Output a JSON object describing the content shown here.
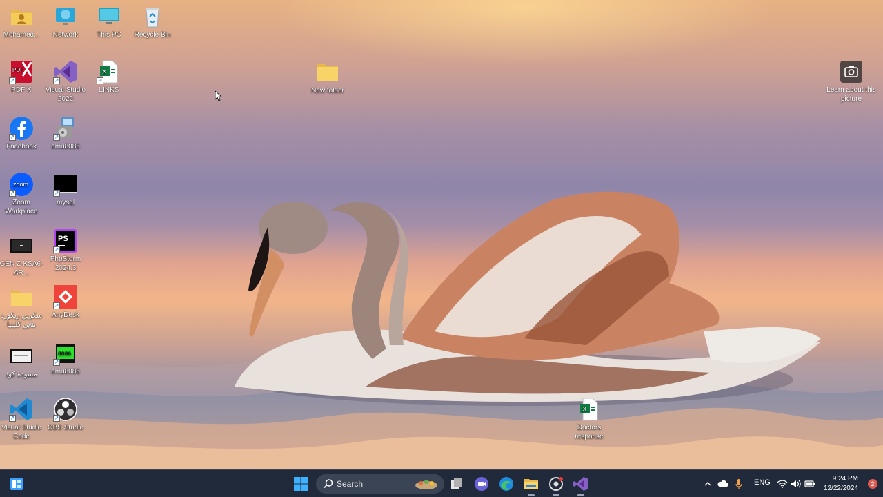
{
  "desktop": {
    "icons": [
      {
        "label": "Mohamed...",
        "icon": "user-folder-icon"
      },
      {
        "label": "Network",
        "icon": "network-icon"
      },
      {
        "label": "This PC",
        "icon": "this-pc-icon"
      },
      {
        "label": "Recycle Bin",
        "icon": "recycle-bin-icon"
      },
      {
        "label": "PDF X",
        "icon": "pdf-x-icon"
      },
      {
        "label": "Visual Studio 2022",
        "icon": "visual-studio-icon"
      },
      {
        "label": "LINKS",
        "icon": "excel-file-icon"
      },
      {
        "label": "Facebook",
        "icon": "facebook-icon"
      },
      {
        "label": "emu8086",
        "icon": "emu8086-installer-icon"
      },
      {
        "label": "Zoom Workplace",
        "icon": "zoom-icon"
      },
      {
        "label": "mysql",
        "icon": "terminal-icon"
      },
      {
        "label": "GEN Z-KSA6-AR...",
        "icon": "video-file-icon"
      },
      {
        "label": "PhpStorm 2024.3",
        "icon": "phpstorm-icon"
      },
      {
        "label": "سكرين ريكورد هاين كلينيا",
        "icon": "folder-icon"
      },
      {
        "label": "AnyDesk",
        "icon": "anydesk-icon"
      },
      {
        "label": "مسودة كود",
        "icon": "video-file-icon"
      },
      {
        "label": "emu8086",
        "icon": "emu8086-chip-icon"
      },
      {
        "label": "Visual Studio Code",
        "icon": "vscode-icon"
      },
      {
        "label": "OBS Studio",
        "icon": "obs-icon"
      },
      {
        "label": "New folder",
        "icon": "folder-icon"
      },
      {
        "label": "Doctors response",
        "icon": "excel-file-icon"
      }
    ],
    "learn_about_picture": {
      "label": "Learn about this picture",
      "icon": "camera-icon"
    }
  },
  "taskbar": {
    "search_label": "Search",
    "apps": [
      "widgets-icon",
      "windows-start-icon",
      "search-icon",
      "task-view-icon",
      "teams-chat-icon",
      "edge-icon",
      "file-explorer-icon",
      "chrome-devtools-icon",
      "visual-studio-icon"
    ],
    "tray": {
      "language": "ENG",
      "time": "9:24 PM",
      "date": "12/22/2024",
      "notification_count": "2"
    }
  },
  "colors": {
    "taskbar_bg": "#202a3a",
    "search_bg": "#3b4454",
    "badge": "#e05a52"
  }
}
